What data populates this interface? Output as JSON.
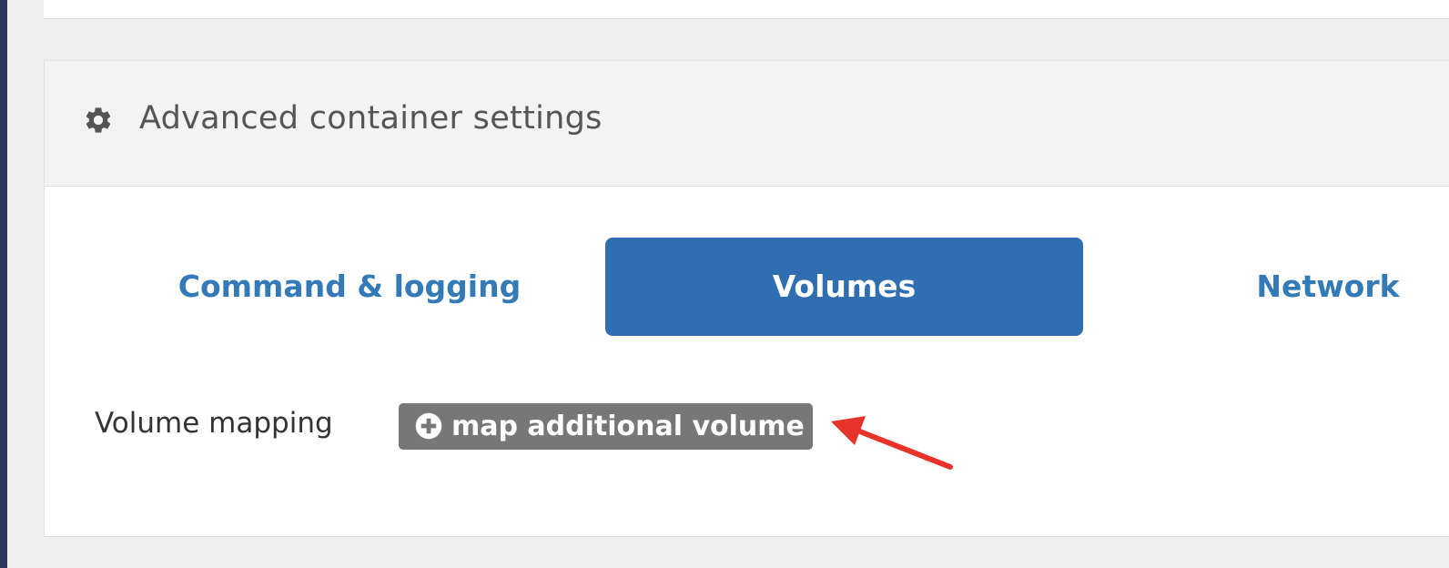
{
  "widget": {
    "title": "Advanced container settings",
    "icon": "gear-icon"
  },
  "tabs": [
    {
      "label": "Command & logging",
      "active": false
    },
    {
      "label": "Volumes",
      "active": true
    },
    {
      "label": "Network",
      "active": false
    }
  ],
  "volumes": {
    "label": "Volume mapping",
    "add_button_label": "map additional volume",
    "add_button_icon": "plus-circle-icon"
  },
  "annotation": {
    "icon": "red-arrow-icon",
    "color": "#e8332a"
  },
  "colors": {
    "accent": "#337ab7",
    "active_tab": "#2f6eb0",
    "button_gray": "#777777"
  }
}
